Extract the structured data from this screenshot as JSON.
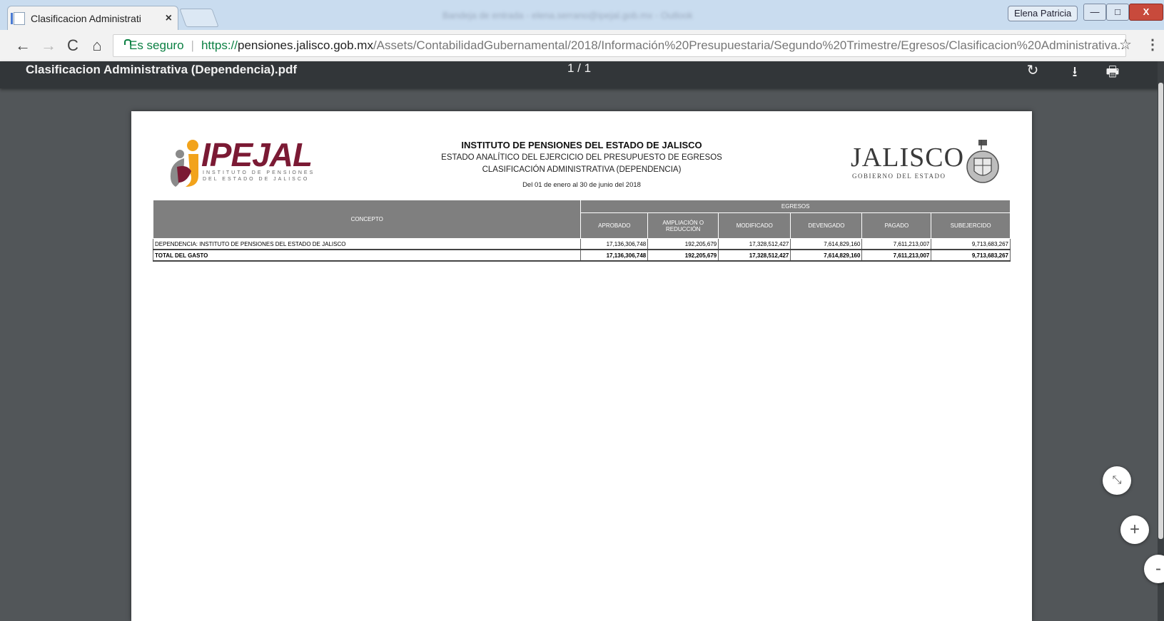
{
  "browser": {
    "tab_title": "Clasificacion Administrati",
    "tab_close": "×",
    "user_name": "Elena Patricia",
    "window_min": "—",
    "window_max": "□",
    "window_close": "X",
    "blurred_title": "Bandeja de entrada - elena.serrano@ipejal.gob.mx - Outlook"
  },
  "toolbar": {
    "back": "←",
    "forward": "→",
    "reload": "C",
    "home": "⌂",
    "secure_label": "Es seguro",
    "separator": "|",
    "url_scheme": "https://",
    "url_host": "pensiones.jalisco.gob.mx",
    "url_path": "/Assets/ContabilidadGubernamental/2018/Información%20Presupuestaria/Segundo%20Trimestre/Egresos/Clasificacion%20Administrativa...",
    "star": "☆",
    "menu": "⋮"
  },
  "pdf": {
    "filename": "Clasificacion Administrativa (Dependencia).pdf",
    "page_indicator": "1 / 1",
    "rotate_icon": "↻",
    "download_icon": "⭳",
    "print_icon": "🖶"
  },
  "document": {
    "logo_left": "IPEJAL",
    "logo_left_sub1": "INSTITUTO DE PENSIONES",
    "logo_left_sub2": "DEL ESTADO DE JALISCO",
    "heading1": "INSTITUTO DE PENSIONES DEL ESTADO DE JALISCO",
    "heading2": "ESTADO ANALÍTICO DEL EJERCICIO DEL PRESUPUESTO DE EGRESOS",
    "heading3": "CLASIFICACIÓN ADMINISTRATIVA (DEPENDENCIA)",
    "period": "Del 01 de enero al 30 de junio del 2018",
    "logo_right": "JALISCO",
    "logo_right_sub": "GOBIERNO DEL ESTADO",
    "table": {
      "concept_header": "CONCEPTO",
      "group_header": "EGRESOS",
      "columns": [
        "APROBADO",
        "AMPLIACIÓN O REDUCCIÓN",
        "MODIFICADO",
        "DEVENGADO",
        "PAGADO",
        "SUBEJERCIDO"
      ],
      "rows": [
        {
          "concept": "DEPENDENCIA: INSTITUTO DE PENSIONES DEL ESTADO DE JALISCO",
          "values": [
            "17,136,306,748",
            "192,205,679",
            "17,328,512,427",
            "7,614,829,160",
            "7,611,213,007",
            "9,713,683,267"
          ]
        }
      ],
      "total": {
        "concept": "TOTAL DEL GASTO",
        "values": [
          "17,136,306,748",
          "192,205,679",
          "17,328,512,427",
          "7,614,829,160",
          "7,611,213,007",
          "9,713,683,267"
        ]
      }
    }
  },
  "controls": {
    "fit": "⤡",
    "zoom_in": "+",
    "zoom_out": "-"
  }
}
